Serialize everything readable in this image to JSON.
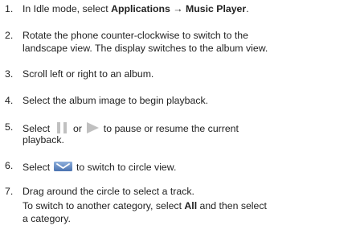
{
  "steps": [
    {
      "number": "1.",
      "pre": "In Idle mode, select ",
      "bold1": "Applications",
      "arrow": " → ",
      "bold2": "Music Player",
      "post": "."
    },
    {
      "number": "2.",
      "line1": "Rotate the phone counter-clockwise to switch to the",
      "line2": "landscape view. The display switches to the album view."
    },
    {
      "number": "3.",
      "text": "Scroll left or right to an album."
    },
    {
      "number": "4.",
      "text": "Select the album image to begin playback."
    },
    {
      "number": "5.",
      "pre": "Select ",
      "mid": " or ",
      "post": " to pause or resume the current",
      "line2": "playback.",
      "icon_pause": "pause-icon",
      "icon_play": "play-icon"
    },
    {
      "number": "6.",
      "pre": "Select ",
      "post": " to switch to circle view.",
      "icon": "circle-view-icon"
    },
    {
      "number": "7.",
      "line1": "Drag around the circle to select a track.",
      "line2_pre": "To switch to another category, select ",
      "line2_bold": "All",
      "line2_post": " and then select",
      "line3": "a category."
    }
  ],
  "colors": {
    "text": "#222222",
    "icon_gray": "#b8b8b8",
    "icon_blue": "#6a8fc4"
  }
}
